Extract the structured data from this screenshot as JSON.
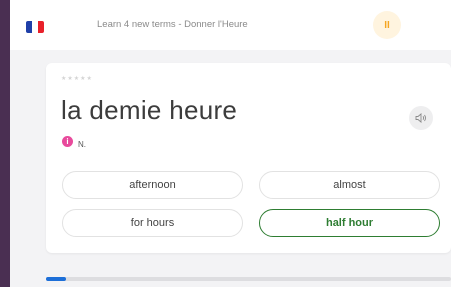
{
  "header": {
    "lesson_title": "Learn 4 new terms - Donner l'Heure",
    "pause_icon": "pause-icon",
    "pause_label": "II",
    "flag_colors": [
      "#1f3fa8",
      "#ffffff",
      "#e8202a"
    ],
    "pause_bg": "#fff4df",
    "pause_color": "#f5a623"
  },
  "card": {
    "stars": "★★★★★",
    "term": "la demie heure",
    "part_of_speech": "N.",
    "info_icon": "info-icon",
    "info_glyph": "i",
    "info_color": "#e84a9c",
    "speaker_icon": "speaker-icon"
  },
  "options": [
    {
      "label": "afternoon",
      "state": "default"
    },
    {
      "label": "almost",
      "state": "default"
    },
    {
      "label": "for hours",
      "state": "default"
    },
    {
      "label": "half hour",
      "state": "correct"
    }
  ],
  "progress": {
    "fraction": 0.05,
    "color": "#1d6fd8"
  },
  "colors": {
    "correct": "#2e7d32",
    "frame": "#4a2f52"
  }
}
